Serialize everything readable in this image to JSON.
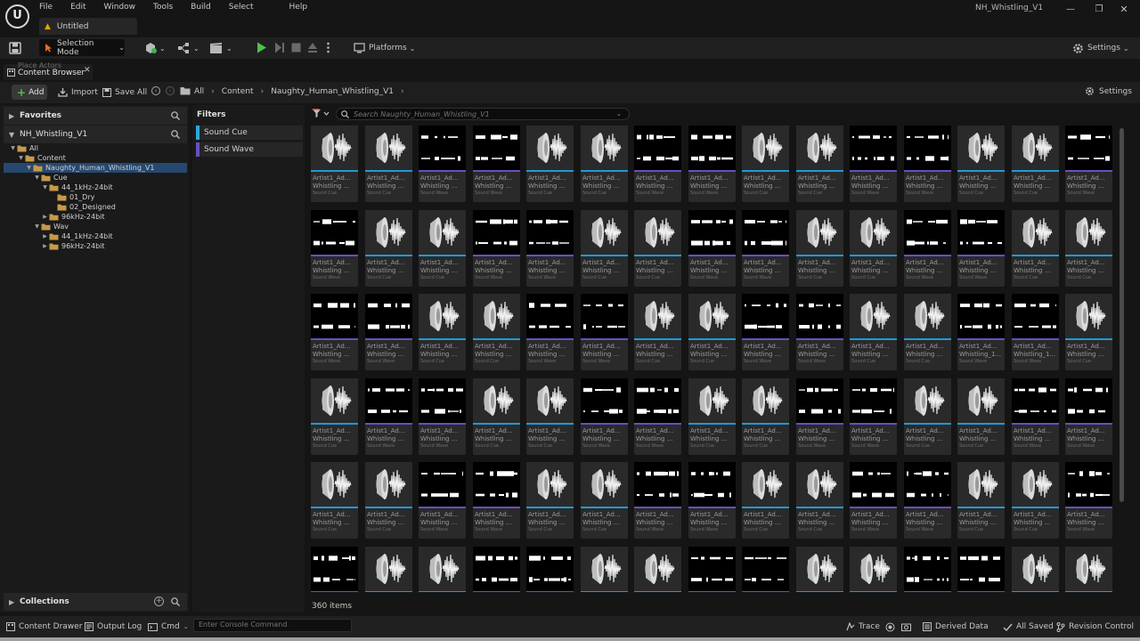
{
  "app": {
    "logo": "U",
    "menu": [
      "File",
      "Edit",
      "Window",
      "Tools",
      "Build",
      "Select",
      "Help"
    ],
    "document_tab": "Untitled",
    "project_title": "NH_Whistling_V1",
    "window_controls": {
      "minimize": "—",
      "maximize": "❐",
      "close": "✕"
    }
  },
  "toolbar": {
    "selection_mode": "Selection Mode",
    "platforms": "Platforms",
    "settings": "Settings"
  },
  "panel_tab": {
    "label": "Content Browser",
    "ghost_label": "Place Actors",
    "close": "✕"
  },
  "pathbar": {
    "add": "Add",
    "import": "Import",
    "save_all": "Save All",
    "crumbs": [
      "All",
      "Content",
      "Naughty_Human_Whistling_V1"
    ],
    "settings": "Settings"
  },
  "sidebar": {
    "favorites": "Favorites",
    "project": "NH_Whistling_V1",
    "collections": "Collections",
    "tree": [
      {
        "label": "All",
        "indent": 0,
        "open": true,
        "selected": false
      },
      {
        "label": "Content",
        "indent": 1,
        "open": true,
        "selected": false
      },
      {
        "label": "Naughty_Human_Whistling_V1",
        "indent": 2,
        "open": true,
        "selected": true
      },
      {
        "label": "Cue",
        "indent": 3,
        "open": true,
        "selected": false
      },
      {
        "label": "44_1kHz-24bit",
        "indent": 4,
        "open": true,
        "selected": false
      },
      {
        "label": "01_Dry",
        "indent": 5,
        "open": false,
        "leaf": true,
        "selected": false
      },
      {
        "label": "02_Designed",
        "indent": 5,
        "open": false,
        "leaf": true,
        "selected": false
      },
      {
        "label": "96kHz-24bit",
        "indent": 4,
        "open": false,
        "selected": false
      },
      {
        "label": "Wav",
        "indent": 3,
        "open": true,
        "selected": false
      },
      {
        "label": "44_1kHz-24bit",
        "indent": 4,
        "open": false,
        "selected": false
      },
      {
        "label": "96kHz-24bit",
        "indent": 4,
        "open": false,
        "selected": false
      }
    ]
  },
  "filters": {
    "title": "Filters",
    "items": [
      {
        "label": "Sound Cue",
        "color": "#29a8e0"
      },
      {
        "label": "Sound Wave",
        "color": "#6a4ec0"
      }
    ]
  },
  "assets": {
    "search_placeholder": "Search Naughty_Human_Whistling_V1",
    "item_count": "360 items",
    "colors": {
      "cue": "#1f9ad6",
      "wave": "#6a4ec0"
    },
    "type_labels": {
      "C": "Sound Cue",
      "W": "Sound Wave"
    },
    "rows": [
      {
        "name1": [
          "Artist1_Ad...",
          "Artist1_Ad...",
          "Artist1_Ad...",
          "Artist1_Ad...",
          "Artist1_Ad...",
          "Artist1_Ad...",
          "Artist1_Ad...",
          "Artist1_Ad...",
          "Artist1_Ad...",
          "Artist1_Ad...",
          "Artist1_Ad...",
          "Artist1_Ad...",
          "Artist1_Ad...",
          "Artist1_Ad...",
          "Artist1_Ad..."
        ],
        "name2": [
          "Whistling ...",
          "Whistling ...",
          "Whistling ...",
          "Whistling ...",
          "Whistling ...",
          "Whistling ...",
          "Whistling ...",
          "Whistling ...",
          "Whistling ...",
          "Whistling ...",
          "Whistling ...",
          "Whistling ...",
          "Whistling ...",
          "Whistling ...",
          "Whistling ..."
        ],
        "types": "CCWWCCWWCCWWCCW"
      },
      {
        "name1": [
          "Artist1_Ad...",
          "Artist1_Ad...",
          "Artist1_Ad...",
          "Artist1_Ad...",
          "Artist1_Ad...",
          "Artist1_Ad...",
          "Artist1_Ad...",
          "Artist1_Ad...",
          "Artist1_Ad...",
          "Artist1_Ad...",
          "Artist1_Ad...",
          "Artist1_Ad...",
          "Artist1_Ad...",
          "Artist1_Ad...",
          "Artist1_Ad..."
        ],
        "name2": [
          "Whistling ...",
          "Whistling ...",
          "Whistling ...",
          "Whistling ...",
          "Whistling ...",
          "Whistling ...",
          "Whistling ...",
          "Whistling ...",
          "Whistling ...",
          "Whistling ...",
          "Whistling ...",
          "Whistling ...",
          "Whistling ...",
          "Whistling ...",
          "Whistling ..."
        ],
        "types": "WCCWWCCWWCCWWCC"
      },
      {
        "name1": [
          "Artist1_Ad...",
          "Artist1_Ad...",
          "Artist1_Ad...",
          "Artist1_Ad...",
          "Artist1_Ad...",
          "Artist1_Ad...",
          "Artist1_Ad...",
          "Artist1_Ad...",
          "Artist1_Ad...",
          "Artist1_Ad...",
          "Artist1_Ad...",
          "Artist1_Ad...",
          "Artist1_Ad...",
          "Artist1_Ad...",
          "Artist1_Ad..."
        ],
        "name2": [
          "Whistling ...",
          "Whistling ...",
          "Whistling ...",
          "Whistling ...",
          "Whistling ...",
          "Whistling ...",
          "Whistling ...",
          "Whistling ...",
          "Whistling ...",
          "Whistling ...",
          "Whistling ...",
          "Whistling ...",
          "Whistling_1...",
          "Whistling_1...",
          "Whistling ..."
        ],
        "types": "WWCCWWCCWWCCWWC"
      },
      {
        "name1": [
          "Artist1_Ad...",
          "Artist1_Ad...",
          "Artist1_Ad...",
          "Artist1_Ad...",
          "Artist1_Ad...",
          "Artist1_Ad...",
          "Artist1_Ad...",
          "Artist1_Ad...",
          "Artist1_Ad...",
          "Artist1_Ad...",
          "Artist1_Ad...",
          "Artist1_Ad...",
          "Artist1_Ad...",
          "Artist1_Ad...",
          "Artist1_Ad..."
        ],
        "name2": [
          "Whistling ...",
          "Whistling ...",
          "Whistling ...",
          "Whistling ...",
          "Whistling ...",
          "Whistling ...",
          "Whistling ...",
          "Whistling ...",
          "Whistling ...",
          "Whistling ...",
          "Whistling ...",
          "Whistling ...",
          "Whistling ...",
          "Whistling ...",
          "Whistling ..."
        ],
        "types": "CWWCCWWCCWWCCWW"
      },
      {
        "name1": [
          "Artist1_Ad...",
          "Artist1_Ad...",
          "Artist1_Ad...",
          "Artist1_Ad...",
          "Artist1_Ad...",
          "Artist1_Ad...",
          "Artist1_Ad...",
          "Artist1_Ad...",
          "Artist1_Ad...",
          "Artist1_Ad...",
          "Artist1_Ad...",
          "Artist1_Ad...",
          "Artist1_Ad...",
          "Artist1_Ad...",
          "Artist1_Ad..."
        ],
        "name2": [
          "Whistling ...",
          "Whistling ...",
          "Whistling ...",
          "Whistling ...",
          "Whistling ...",
          "Whistling ...",
          "Whistling ...",
          "Whistling ...",
          "Whistling ...",
          "Whistling ...",
          "Whistling ...",
          "Whistling ...",
          "Whistling ...",
          "Whistling ...",
          "Whistling ..."
        ],
        "types": "CCWWCCWWCCWWCCW"
      },
      {
        "name1": [],
        "name2": [],
        "types": "WCCWWCCWWCCWWCC"
      }
    ]
  },
  "statusbar": {
    "content_drawer": "Content Drawer",
    "output_log": "Output Log",
    "cmd": "Cmd",
    "console_placeholder": "Enter Console Command",
    "trace": "Trace",
    "derived_data": "Derived Data",
    "all_saved": "All Saved",
    "revision_control": "Revision Control"
  }
}
